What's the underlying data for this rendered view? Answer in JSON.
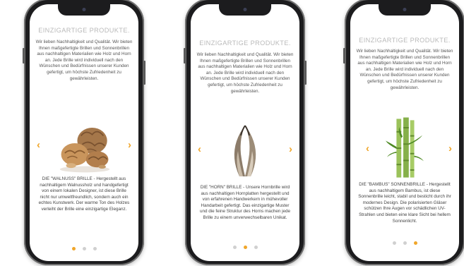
{
  "colors": {
    "accent": "#f0a62a",
    "title_gray": "#b9b9b9",
    "text_gray": "#555555",
    "phone_frame": "#1c1c1e"
  },
  "icons": {
    "prev": "chevron-left-icon",
    "next": "chevron-right-icon"
  },
  "arrow_prev": "‹",
  "arrow_next": "›",
  "phones": [
    {
      "title": "EINZIGARTIGE PRODUKTE.",
      "description": "Wir lieben Nachhaltigkeit und Qualität. Wir bieten Ihnen maßgefertigte Brillen und Sonnenbrillen aus nachhaltigen Materialien wie Holz und Horn an. Jede Brille wird individuell nach den Wünschen und Bedürfnissen unserer Kunden gefertigt, um höchste Zufriedenheit zu gewährleisten.",
      "product_image": "walnuts",
      "caption": "DIE \"WALNUSS\" BRILLE - Hergestellt aus nachhaltigem Walnussholz und handgefertigt von einem lokalen Designer, ist diese Brille nicht nur umweltfreundlich, sondern auch ein echtes Kunstwerk. Der warme Ton des Holzes verleiht der Brille eine einzigartige Eleganz.",
      "active_dot": 0
    },
    {
      "title": "EINZIGARTIGE PRODUKTE.",
      "description": "Wir lieben Nachhaltigkeit und Qualität. Wir bieten Ihnen maßgefertigte Brillen und Sonnenbrillen aus nachhaltigen Materialien wie Holz und Horn an. Jede Brille wird individuell nach den Wünschen und Bedürfnissen unserer Kunden gefertigt, um höchste Zufriedenheit zu gewährleisten.",
      "product_image": "horns",
      "caption": "DIE \"HORN\" BRILLE - Unsere Hornbrille wird aus nachhaltigen Hornplatten hergestellt und von erfahrenen Handwerkern in mühevoller Handarbeit gefertigt. Das einzigartige Muster und die feine Struktur des Horns machen jede Brille zu einem unverwechselbaren Unikat.",
      "active_dot": 1
    },
    {
      "title": "EINZIGARTIGE PRODUKTE.",
      "description": "Wir lieben Nachhaltigkeit und Qualität. Wir bieten Ihnen maßgefertigte Brillen und Sonnenbrillen aus nachhaltigen Materialien wie Holz und Horn an. Jede Brille wird individuell nach den Wünschen und Bedürfnissen unserer Kunden gefertigt, um höchste Zufriedenheit zu gewährleisten.",
      "product_image": "bamboo",
      "caption": "DIE \"BAMBUS\" SONNENBRILLE - Hergestellt aus nachhaltigem Bambus, ist diese Sonnenbrille leicht, stabil und besticht durch ihr modernes Design. Die polarisierten Gläser schützen Ihre Augen vor schädlichen UV-Strahlen und bieten eine klare Sicht bei hellem Sonnenlicht.",
      "active_dot": 2
    }
  ]
}
